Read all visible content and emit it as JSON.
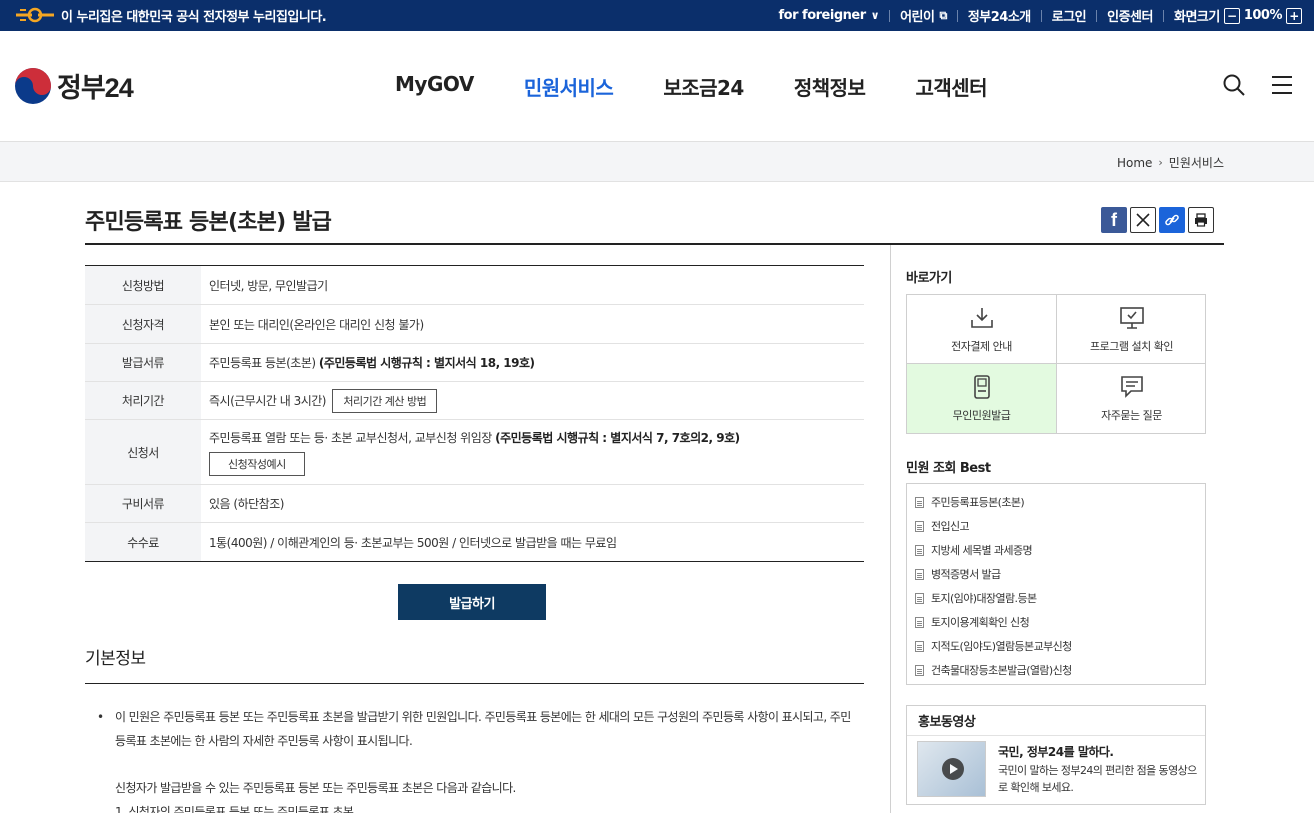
{
  "govbar": {
    "notice": "이 누리집은 대한민국 공식 전자정부 누리집입니다.",
    "links": [
      "for foreigner",
      "어린이",
      "정부24소개",
      "로그인",
      "인증센터"
    ],
    "zoom_label": "화면크기",
    "zoom_value": "100%"
  },
  "header": {
    "logo": "정부24",
    "menu": [
      "MyGOV",
      "민원서비스",
      "보조금24",
      "정책정보",
      "고객센터"
    ]
  },
  "breadcrumb": [
    "Home",
    "민원서비스"
  ],
  "page": {
    "title": "주민등록표 등본(초본) 발급",
    "issue_button": "발급하기",
    "basic_info_title": "기본정보",
    "desc1": "이 민원은 주민등록표 등본 또는 주민등록표 초본을 발급받기 위한 민원입니다. 주민등록표 등본에는 한 세대의 모든 구성원의 주민등록 사항이 표시되고, 주민등록표 초본에는 한 사람의 자세한 주민등록 사항이 표시됩니다.",
    "desc2": "신청자가 발급받을 수 있는 주민등록표 등본 또는 주민등록표 초본은 다음과 같습니다.",
    "desc3": "1. 신청자의 주민등록표 등본 또는 주민등록표 초본"
  },
  "info": {
    "method_k": "신청방법",
    "method_v": "인터넷, 방문, 무인발급기",
    "qual_k": "신청자격",
    "qual_v": "본인 또는 대리인(온라인은 대리인 신청 불가)",
    "doc_k": "발급서류",
    "doc_v": "주민등록표 등본(초본) ",
    "doc_b": "(주민등록법 시행규칙 : 별지서식 18, 19호)",
    "period_k": "처리기간",
    "period_v": "즉시(근무시간 내 3시간)",
    "period_btn": "처리기간 계산 방법",
    "form_k": "신청서",
    "form_v": "주민등록표 열람 또는 등· 초본 교부신청서, 교부신청 위임장 ",
    "form_b": "(주민등록법 시행규칙 : 별지서식 7, 7호의2, 9호)",
    "form_btn": "신청작성예시",
    "req_k": "구비서류",
    "req_v": "있음 (하단참조)",
    "fee_k": "수수료",
    "fee_v": "1통(400원) / 이해관계인의 등· 초본교부는 500원 / 인터넷으로 발급받을 때는 무료임"
  },
  "sidebar": {
    "shortcut_title": "바로가기",
    "shortcuts": [
      "전자결제 안내",
      "프로그램 설치 확인",
      "무인민원발급",
      "자주묻는 질문"
    ],
    "best_title": "민원 조회 Best",
    "best": [
      "주민등록표등본(초본)",
      "전입신고",
      "지방세 세목별 과세증명",
      "병적증명서 발급",
      "토지(임야)대장열람.등본",
      "토지이용계획확인 신청",
      "지적도(임야도)열람등본교부신청",
      "건축물대장등초본발급(열람)신청"
    ],
    "promo_title": "홍보동영상",
    "promo_head": "국민, 정부24를 말하다.",
    "promo_desc": "국민이 말하는 정부24의 편리한 점을 동영상으로 확인해 보세요."
  },
  "colors": {
    "navy": "#0b2f6b",
    "active_menu": "#1b64da",
    "issue_btn": "#0e3a62",
    "highlight": "#e3fae0"
  }
}
